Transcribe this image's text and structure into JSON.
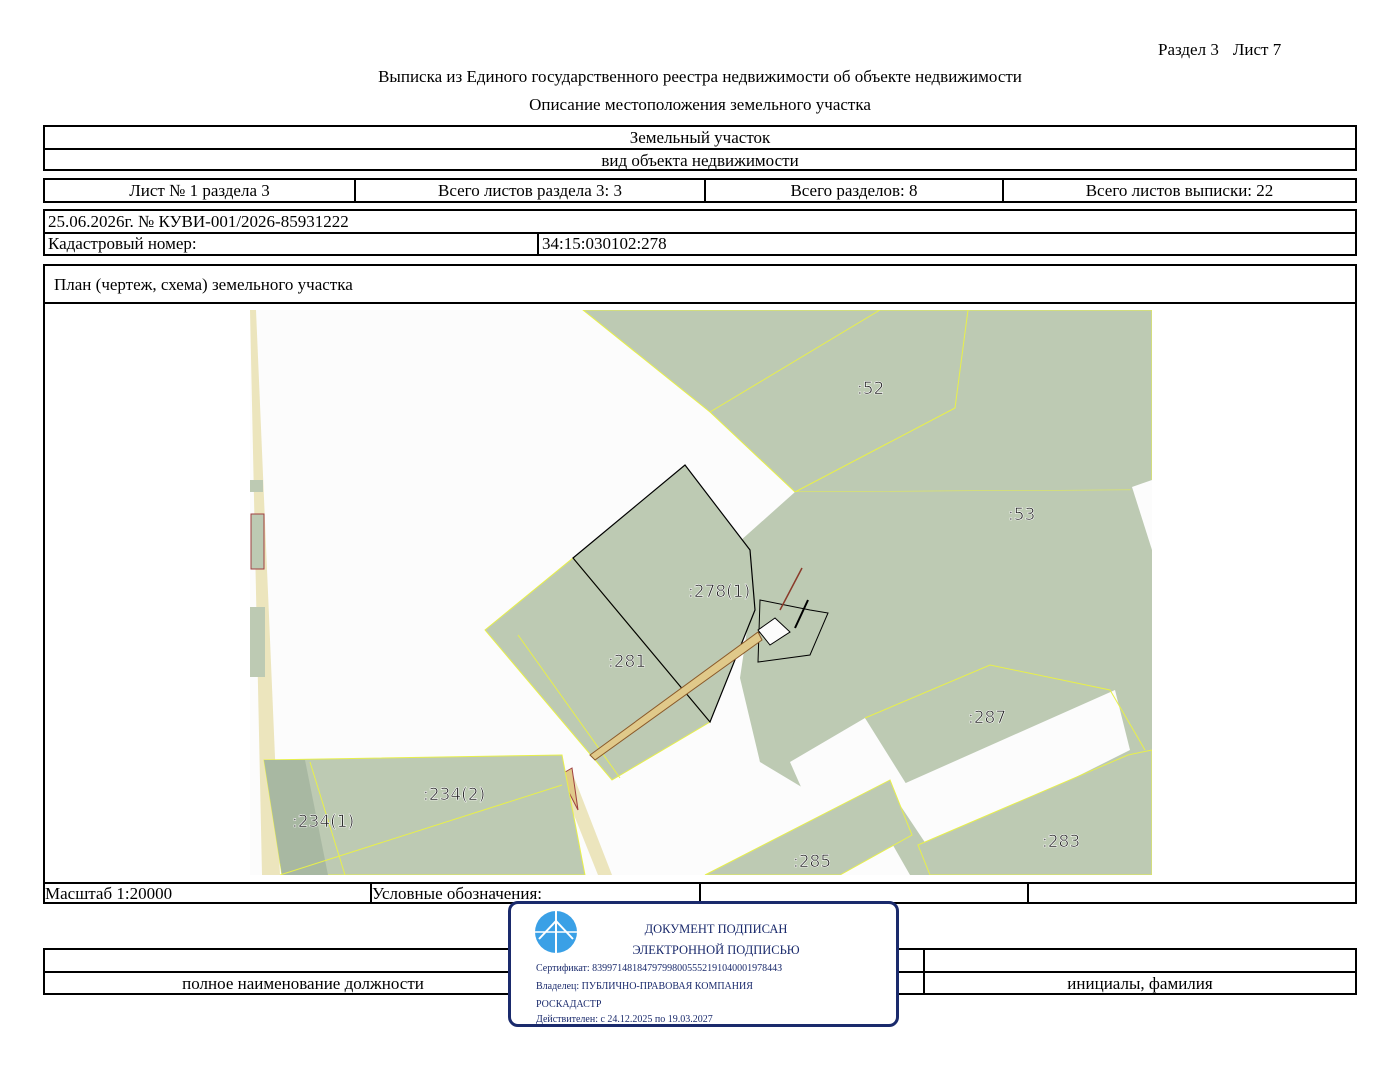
{
  "header": {
    "section": "Раздел 3",
    "sheet": "Лист 7",
    "title": "Выписка из Единого государственного реестра недвижимости об объекте недвижимости",
    "subtitle": "Описание местоположения земельного участка"
  },
  "object": {
    "type_value": "Земельный участок",
    "type_caption": "вид объекта недвижимости"
  },
  "sheets": {
    "sheet_no": "Лист № 1 раздела 3",
    "total_section_sheets": "Всего листов раздела 3: 3",
    "total_sections": "Всего разделов: 8",
    "total_extract_sheets": "Всего листов выписки: 22"
  },
  "document": {
    "date_number": "25.06.2026г. № КУВИ-001/2026-85931222",
    "cadastral_label": "Кадастровый номер:",
    "cadastral_value": "34:15:030102:278"
  },
  "plan": {
    "title": "План (чертеж, схема) земельного участка",
    "scale": "Масштаб 1:20000",
    "legend_label": "Условные обозначения:",
    "parcel_labels": [
      ":52",
      ":53",
      ":278(1)",
      ":281",
      ":287",
      ":234(2)",
      ":234(1)",
      ":283",
      ":285"
    ]
  },
  "signature": {
    "position_caption": "полное наименование должности",
    "name_caption": "инициалы, фамилия"
  },
  "stamp": {
    "line1": "ДОКУМЕНТ ПОДПИСАН",
    "line2": "ЭЛЕКТРОННОЙ ПОДПИСЬЮ",
    "certificate": "Сертификат: 8399714818479799800555219104000197844З",
    "owner": "Владелец: ПУБЛИЧНО-ПРАВОВАЯ КОМПАНИЯ",
    "owner2": "РОСКАДАСТР",
    "valid": "Действителен: с 24.12.2025 по 19.03.2027"
  },
  "colors": {
    "parcel_fill": "#bdcab3",
    "parcel_border": "#e8f04a",
    "road_fill": "#ece5bd",
    "target_border": "#000000",
    "stamp_color": "#1a2a6c",
    "logo_color": "#3aa0e6"
  }
}
